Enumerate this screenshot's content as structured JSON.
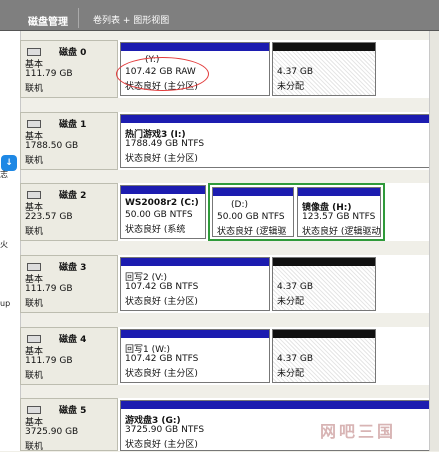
{
  "header": {
    "title": "磁盘管理",
    "view": "卷列表 + 图形视图"
  },
  "sidebar": {
    "texts": [
      "志",
      "火",
      "up"
    ]
  },
  "disks": [
    {
      "name": "磁盘 0",
      "type": "基本",
      "size": "111.79 GB",
      "status": "联机",
      "partitions": [
        {
          "label": "(Y:)",
          "size": "107.42 GB RAW",
          "state": "状态良好 (主分区)",
          "bar": "blue"
        },
        {
          "label": "",
          "size": "4.37 GB",
          "state": "未分配",
          "bar": "black"
        }
      ]
    },
    {
      "name": "磁盘 1",
      "type": "基本",
      "size": "1788.50 GB",
      "status": "联机",
      "partitions": [
        {
          "label": "热门游戏3 (I:)",
          "size": "1788.49 GB NTFS",
          "state": "状态良好 (主分区)",
          "bar": "blue"
        }
      ]
    },
    {
      "name": "磁盘 2",
      "type": "基本",
      "size": "223.57 GB",
      "status": "联机",
      "partitions": [
        {
          "label": "WS2008r2 (C:)",
          "size": "50.00 GB NTFS",
          "state": "状态良好 (系统",
          "bar": "blue"
        },
        {
          "label": "(D:)",
          "size": "50.00 GB NTFS",
          "state": "状态良好 (逻辑驱",
          "bar": "blue"
        },
        {
          "label": "镜像盘 (H:)",
          "size": "123.57 GB NTFS",
          "state": "状态良好 (逻辑驱动",
          "bar": "blue"
        }
      ]
    },
    {
      "name": "磁盘 3",
      "type": "基本",
      "size": "111.79 GB",
      "status": "联机",
      "partitions": [
        {
          "label": "回写2 (V:)",
          "size": "107.42 GB NTFS",
          "state": "状态良好 (主分区)",
          "bar": "blue"
        },
        {
          "label": "",
          "size": "4.37 GB",
          "state": "未分配",
          "bar": "black"
        }
      ]
    },
    {
      "name": "磁盘 4",
      "type": "基本",
      "size": "111.79 GB",
      "status": "联机",
      "partitions": [
        {
          "label": "回写1 (W:)",
          "size": "107.42 GB NTFS",
          "state": "状态良好 (主分区)",
          "bar": "blue"
        },
        {
          "label": "",
          "size": "4.37 GB",
          "state": "未分配",
          "bar": "black"
        }
      ]
    },
    {
      "name": "磁盘 5",
      "type": "基本",
      "size": "3725.90 GB",
      "status": "联机",
      "partitions": [
        {
          "label": "游戏盘3 (G:)",
          "size": "3725.90 GB NTFS",
          "state": "状态良好 (主分区)",
          "bar": "blue"
        }
      ]
    }
  ],
  "watermark": "网吧三国",
  "colors": {
    "primary_bar": "#1c1cb0",
    "unallocated_bar": "#111111",
    "selection": "#2f9a3a",
    "annotation": "#e23b3b"
  }
}
